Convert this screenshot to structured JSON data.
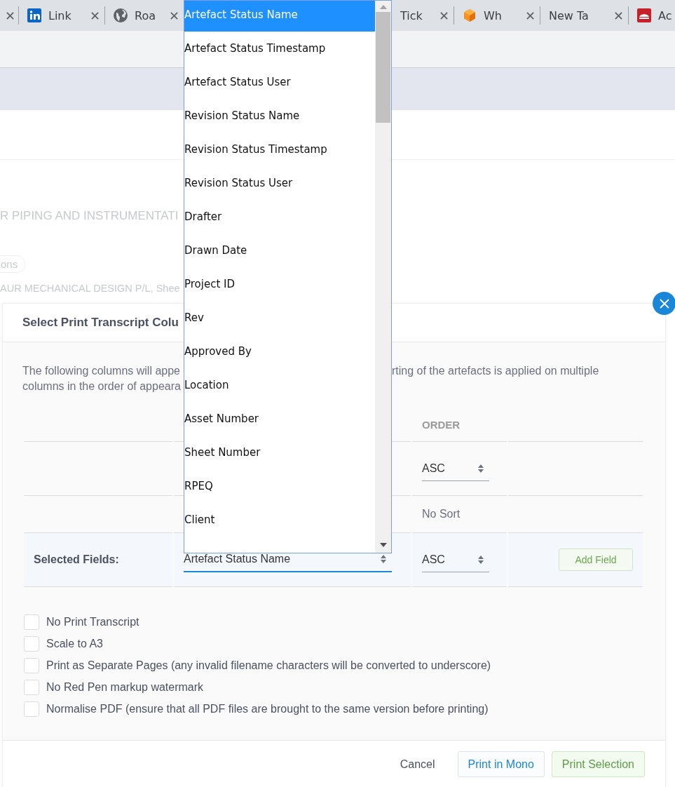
{
  "browser_tabs": [
    {
      "kind": "close-only"
    },
    {
      "label": "Link"
    },
    {
      "label": "Roa"
    },
    {
      "label": "Tick"
    },
    {
      "label": "Wh"
    },
    {
      "label": "New Ta"
    },
    {
      "label": "Ac"
    }
  ],
  "background": {
    "heading": "R PIPING AND INSTRUMENTATI",
    "chip": "ons",
    "subtitle": "AUR MECHANICAL DESIGN P/L, Shee"
  },
  "modal": {
    "title": "Select Print Transcript Colu",
    "description": {
      "line1_left": "The following columns will appe",
      "line1_right": "rting of the artefacts is applied on multiple",
      "line2_left": "columns in the order of appeara"
    },
    "table": {
      "order_header": "ORDER",
      "rows": [
        {
          "kind": "select",
          "order": "ASC"
        },
        {
          "kind": "text",
          "order": "No Sort"
        }
      ],
      "selected_row": {
        "label": "Selected Fields:",
        "field": "Artefact Status Name",
        "order": "ASC",
        "button": "Add Field"
      }
    },
    "checkboxes": [
      {
        "label": "No Print Transcript",
        "checked": false
      },
      {
        "label": "Scale to A3",
        "checked": false
      },
      {
        "label": "Print as Separate Pages (any invalid filename characters will be converted to underscore)",
        "checked": false
      },
      {
        "label": "No Red Pen markup watermark",
        "checked": false
      },
      {
        "label": "Normalise PDF (ensure that all PDF files are brought to the same version before printing)",
        "checked": false
      }
    ],
    "buttons": [
      {
        "label": "Cancel",
        "kind": "plain"
      },
      {
        "label": "Print in Mono",
        "kind": "secondary"
      },
      {
        "label": "Print Selection",
        "kind": "primary"
      }
    ]
  },
  "dropdown": {
    "options": [
      {
        "label": "Artefact Status Name",
        "selected": true
      },
      {
        "label": "Artefact Status Timestamp",
        "selected": false
      },
      {
        "label": "Artefact Status User",
        "selected": false
      },
      {
        "label": "Revision Status Name",
        "selected": false
      },
      {
        "label": "Revision Status Timestamp",
        "selected": false
      },
      {
        "label": "Revision Status User",
        "selected": false
      },
      {
        "label": "Drafter",
        "selected": false
      },
      {
        "label": "Drawn Date",
        "selected": false
      },
      {
        "label": "Project ID",
        "selected": false
      },
      {
        "label": "Rev",
        "selected": false
      },
      {
        "label": "Approved By",
        "selected": false
      },
      {
        "label": "Location",
        "selected": false
      },
      {
        "label": "Asset Number",
        "selected": false
      },
      {
        "label": "Sheet Number",
        "selected": false
      },
      {
        "label": "RPEQ",
        "selected": false
      },
      {
        "label": "Client",
        "selected": false
      }
    ]
  }
}
